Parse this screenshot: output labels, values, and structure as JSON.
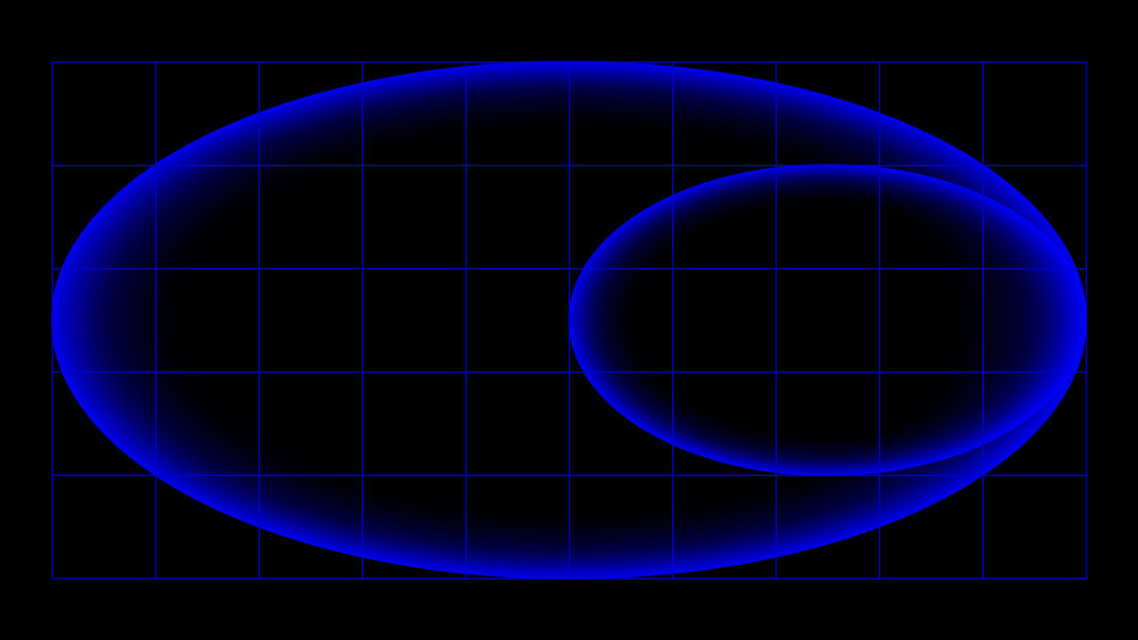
{
  "colors": {
    "background": "#000000",
    "grid_line": "#0000cc",
    "ellipse_glow": "#0000ff",
    "ellipse_core": "#000000"
  },
  "grid": {
    "columns": 10,
    "rows": 5
  },
  "ellipses": [
    {
      "name": "large-ellipse"
    },
    {
      "name": "small-ellipse"
    }
  ]
}
